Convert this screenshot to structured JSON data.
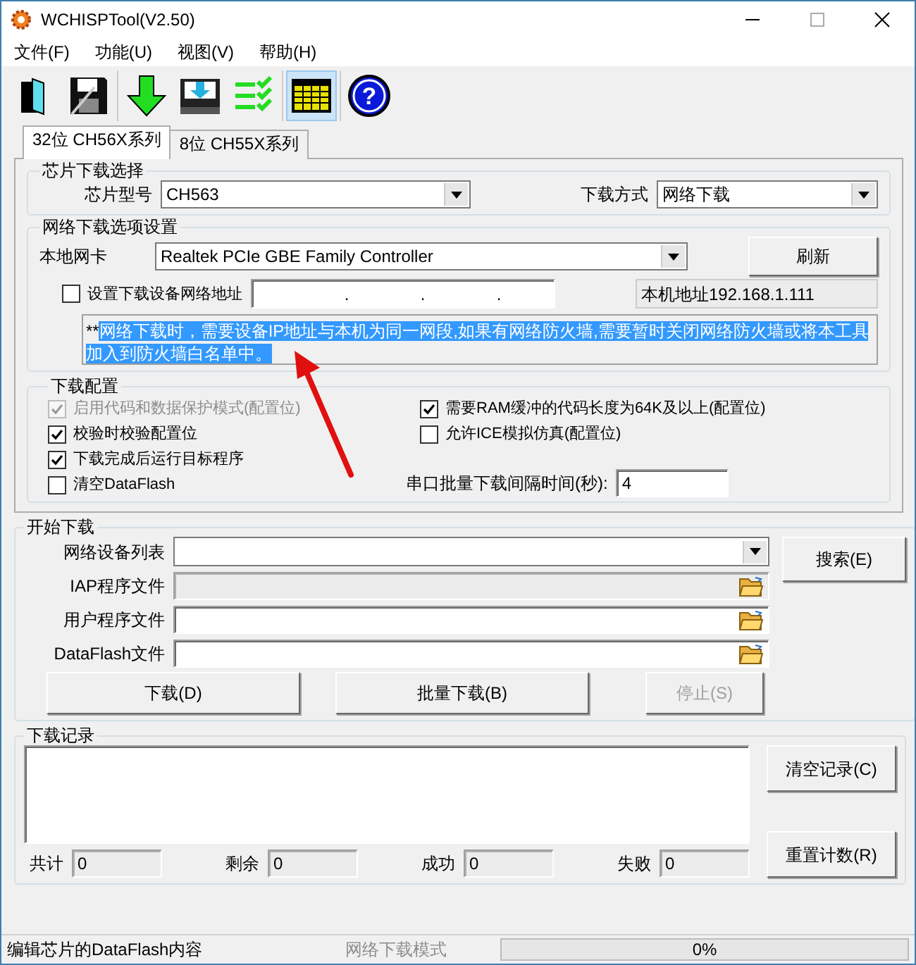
{
  "window": {
    "title": "WCHISPTool(V2.50)"
  },
  "menu": [
    {
      "label": "文件(F)"
    },
    {
      "label": "功能(U)"
    },
    {
      "label": "视图(V)"
    },
    {
      "label": "帮助(H)"
    }
  ],
  "toolbar": [
    {
      "kind": "open",
      "selected": false
    },
    {
      "kind": "save",
      "selected": false
    },
    {
      "kind": "download",
      "selected": false
    },
    {
      "kind": "device",
      "selected": false
    },
    {
      "kind": "checklist",
      "selected": false
    },
    {
      "kind": "grid",
      "selected": true
    },
    {
      "kind": "help",
      "selected": false,
      "glyph": "?"
    }
  ],
  "tabs": [
    {
      "label": "32位 CH56X系列",
      "selected": true
    },
    {
      "label": "8位 CH55X系列",
      "selected": false
    }
  ],
  "chip_group": {
    "title": "芯片下载选择",
    "chip_label": "芯片型号",
    "chip_value": "CH563",
    "mode_label": "下载方式",
    "mode_value": "网络下载"
  },
  "network_group": {
    "title": "网络下载选项设置",
    "nic_label": "本地网卡",
    "nic_value": "Realtek PCIe GBE Family Controller",
    "refresh_button": "刷新",
    "set_address": {
      "label": "设置下载设备网络地址",
      "checked": false
    },
    "ip_dots": [
      ".",
      ".",
      "."
    ],
    "local_address_label": "本机地址",
    "local_address": "192.168.1.111",
    "note_prefix": "**",
    "note_selected": "网络下载时，需要设备IP地址与本机为同一网段,如果有网络防火墙,需要暂时关闭网络防火墙或将本工具加入到防火墙白名单中。"
  },
  "config_group": {
    "title": "下载配置",
    "options_left": [
      {
        "label": "启用代码和数据保护模式(配置位)",
        "checked": true,
        "disabled": true
      },
      {
        "label": "校验时校验配置位",
        "checked": true,
        "disabled": false
      },
      {
        "label": "下载完成后运行目标程序",
        "checked": true,
        "disabled": false
      },
      {
        "label": "清空DataFlash",
        "checked": false,
        "disabled": false
      }
    ],
    "options_right": [
      {
        "label": "需要RAM缓冲的代码长度为64K及以上(配置位)",
        "checked": true,
        "disabled": false
      },
      {
        "label": "允许ICE模拟仿真(配置位)",
        "checked": false,
        "disabled": false
      }
    ],
    "interval_label": "串口批量下载间隔时间(秒):",
    "interval_value": "4"
  },
  "start_group": {
    "title": "开始下载",
    "device_list_label": "网络设备列表",
    "search_button": "搜索(E)",
    "files": [
      {
        "label": "IAP程序文件",
        "disabled": true
      },
      {
        "label": "用户程序文件",
        "disabled": false
      },
      {
        "label": "DataFlash文件",
        "disabled": false
      }
    ],
    "buttons": [
      {
        "label": "下载(D)",
        "disabled": false
      },
      {
        "label": "批量下载(B)",
        "disabled": false
      },
      {
        "label": "停止(S)",
        "disabled": true
      }
    ]
  },
  "log_group": {
    "title": "下载记录",
    "clear_button": "清空记录(C)",
    "reset_button": "重置计数(R)",
    "counters": [
      {
        "label": "共计",
        "value": "0"
      },
      {
        "label": "剩余",
        "value": "0"
      },
      {
        "label": "成功",
        "value": "0"
      },
      {
        "label": "失败",
        "value": "0"
      }
    ]
  },
  "status_bar": {
    "message": "编辑芯片的DataFlash内容",
    "mode": "网络下载模式",
    "progress": {
      "level": 0,
      "reading": "0%"
    }
  }
}
